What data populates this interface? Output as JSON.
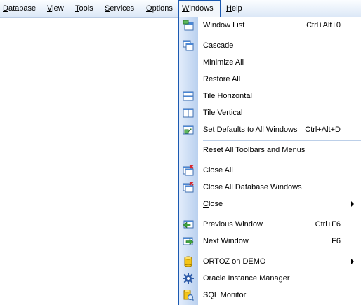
{
  "menubar": [
    {
      "label": "Database",
      "u": "D",
      "rest": "atabase"
    },
    {
      "label": "View",
      "u": "V",
      "rest": "iew"
    },
    {
      "label": "Tools",
      "u": "T",
      "rest": "ools"
    },
    {
      "label": "Services",
      "u": "S",
      "rest": "ervices"
    },
    {
      "label": "Options",
      "u": "O",
      "rest": "ptions"
    },
    {
      "label": "Windows",
      "u": "W",
      "rest": "indows"
    },
    {
      "label": "Help",
      "u": "H",
      "rest": "elp"
    }
  ],
  "windows_menu": {
    "window_list": {
      "label": "Window List",
      "shortcut": "Ctrl+Alt+0",
      "icon": "window-list-icon"
    },
    "cascade": {
      "label": "Cascade",
      "icon": "cascade-icon"
    },
    "minimize_all": {
      "label": "Minimize All"
    },
    "restore_all": {
      "label": "Restore All"
    },
    "tile_horizontal": {
      "label": "Tile Horizontal",
      "icon": "tile-horizontal-icon"
    },
    "tile_vertical": {
      "label": "Tile Vertical",
      "icon": "tile-vertical-icon"
    },
    "set_defaults": {
      "label": "Set Defaults to All Windows",
      "shortcut": "Ctrl+Alt+D",
      "icon": "set-defaults-icon"
    },
    "reset_toolbars": {
      "label": "Reset All Toolbars and Menus"
    },
    "close_all": {
      "label": "Close All",
      "icon": "close-all-icon"
    },
    "close_all_db": {
      "label": "Close All Database Windows",
      "icon": "close-db-windows-icon"
    },
    "close": {
      "label": "Close",
      "u": "C",
      "rest": "lose",
      "submenu": true
    },
    "previous_window": {
      "label": "Previous Window",
      "shortcut": "Ctrl+F6",
      "icon": "previous-window-icon"
    },
    "next_window": {
      "label": "Next Window",
      "shortcut": "F6",
      "icon": "next-window-icon"
    },
    "ortoz": {
      "label": "ORTOZ on DEMO",
      "submenu": true,
      "icon": "database-icon"
    },
    "oracle_instance": {
      "label": "Oracle Instance Manager",
      "icon": "gear-icon"
    },
    "sql_monitor": {
      "label": "SQL Monitor",
      "icon": "sql-monitor-icon"
    }
  }
}
